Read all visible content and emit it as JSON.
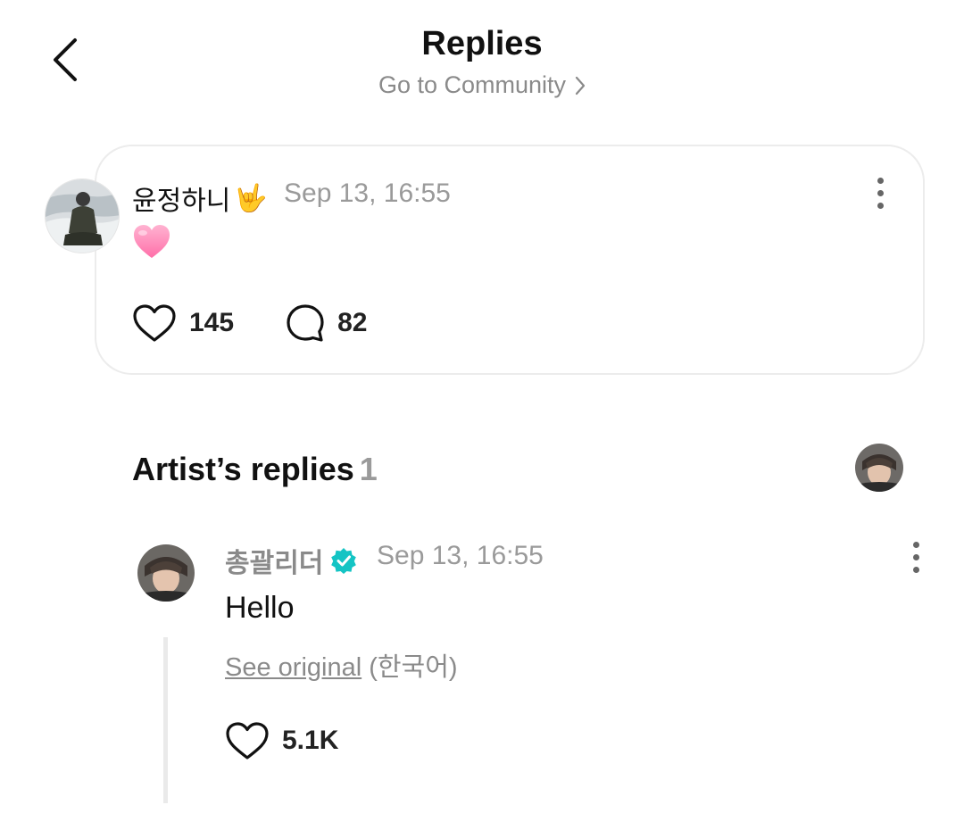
{
  "header": {
    "title": "Replies",
    "community_link": "Go to Community"
  },
  "post": {
    "author": "윤정하니",
    "author_emoji": "🤟",
    "time": "Sep 13, 16:55",
    "body_emoji": "🩷",
    "likes": "145",
    "comments": "82"
  },
  "artist_replies": {
    "title": "Artist’s replies",
    "count": "1",
    "reply": {
      "author": "총괄리더",
      "time": "Sep 13, 16:55",
      "text": "Hello",
      "see_original": "See original",
      "language": "(한국어)",
      "likes": "5.1K"
    }
  },
  "colors": {
    "verified_badge": "#14c4c4",
    "muted_text": "#9a9a9a",
    "card_border": "#ececec"
  },
  "icons": [
    "chevron-left-icon",
    "chevron-right-icon",
    "more-vertical-icon",
    "heart-icon",
    "comment-bubble-icon",
    "verified-badge-icon"
  ]
}
